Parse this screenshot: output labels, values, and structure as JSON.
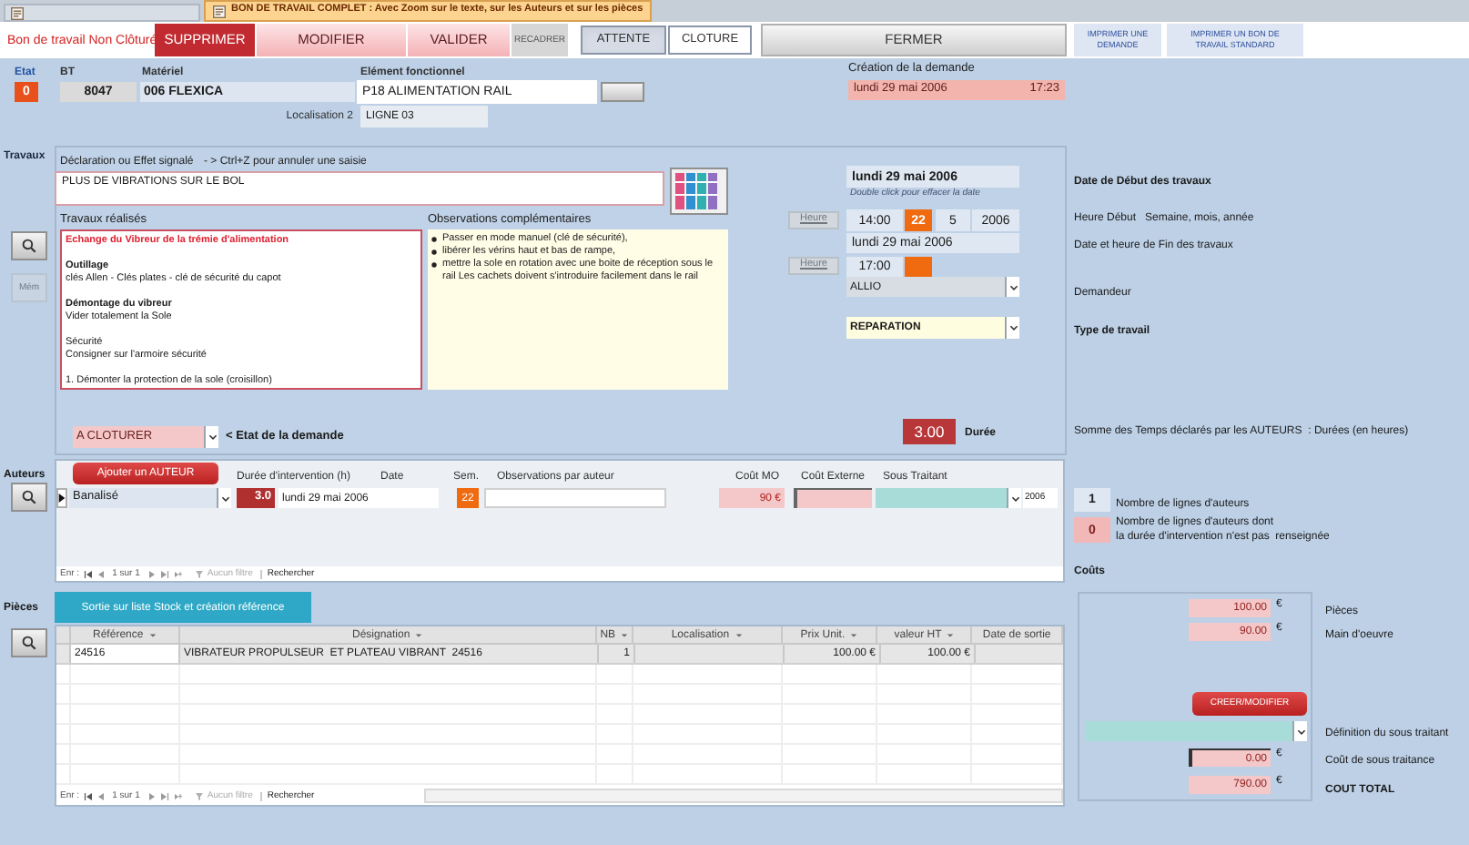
{
  "tabs": [
    {
      "selected": false
    },
    {
      "label": "BON DE TRAVAIL COMPLET : Avec Zoom sur le texte, sur les Auteurs et sur les pièces",
      "selected": true
    }
  ],
  "header": {
    "status": "Bon de travail Non Clôturé",
    "buttons": [
      {
        "label": "SUPPRIMER",
        "kind": "danger"
      },
      {
        "label": "MODIFIER",
        "kind": "action"
      },
      {
        "label": "VALIDER",
        "kind": "action"
      },
      {
        "label": "RECADRER",
        "kind": "minor"
      },
      {
        "label": "ATTENTE",
        "kind": "toggle",
        "selected": true
      },
      {
        "label": "CLOTURE",
        "kind": "toggle",
        "selected": false
      },
      {
        "label": "FERMER",
        "kind": "plain"
      },
      {
        "label": "IMPRIMER UNE DEMANDE",
        "kind": "print"
      },
      {
        "label": "IMPRIMER UN BON DE TRAVAIL STANDARD",
        "kind": "print"
      }
    ]
  },
  "identification": {
    "etat": {
      "label": "Etat",
      "value": "0"
    },
    "bt": {
      "label": "BT",
      "value": "8047"
    },
    "materiel": {
      "label": "Matériel",
      "value": "006 FLEXICA"
    },
    "element": {
      "label": "Elément fonctionnel",
      "value": "P18 ALIMENTATION RAIL"
    },
    "localisation": {
      "label": "Localisation 2",
      "value": "LIGNE 03"
    },
    "creation": {
      "label": "Création de la demande",
      "date": "lundi 29 mai 2006",
      "time": "17:23"
    }
  },
  "travaux": {
    "label": "Travaux",
    "side_buttons": [
      {
        "kind": "zoom",
        "disabled": false
      },
      {
        "kind": "memo",
        "label": "Mém",
        "disabled": true
      }
    ],
    "declaration": {
      "label": "Déclaration ou Effet signalé",
      "hint": "- > Ctrl+Z pour annuler une saisie",
      "value": "PLUS DE VIBRATIONS SUR LE BOL"
    },
    "realises": {
      "label": "Travaux réalisés",
      "blocks": [
        {
          "kind": "title",
          "lines": [
            "Echange du Vibreur de la trémie d'alimentation"
          ]
        },
        {
          "kind": "section",
          "heading": "Outillage",
          "lines": [
            " clés Allen - Clés plates - clé de sécurité du capot"
          ]
        },
        {
          "kind": "section",
          "heading": "Démontage du vibreur",
          "lines": [
            "Vider totalement la Sole"
          ]
        },
        {
          "kind": "plain",
          "lines": [
            "Sécurité",
            "Consigner sur l'armoire sécurité"
          ]
        },
        {
          "kind": "plain",
          "lines": [
            "1. Démonter la protection de la sole (croisillon)"
          ]
        }
      ]
    },
    "observations": {
      "label": "Observations complémentaires",
      "bullets": [
        "Passer en mode manuel (clé de sécurité),",
        "libérer les vérins haut et bas de rampe,",
        "mettre la sole en rotation avec une boite de réception sous le rail  Les cachets doivent s'introduire facilement dans le rail"
      ]
    },
    "planning": {
      "start_date": "lundi 29 mai 2006",
      "hint": "Double click pour effacer la date",
      "start_button": {
        "label": "Heure",
        "disabled": true
      },
      "start_time": "14:00",
      "week": "22",
      "month": "5",
      "year": "2006",
      "end_date": "lundi 29 mai 2006",
      "end_button": {
        "label": "Heure",
        "disabled": true
      },
      "end_time": "17:00",
      "demandeur": "ALLIO",
      "type": "REPARATION"
    },
    "label_start": "Date de Début des travaux",
    "label_start_time": "Heure Début   Semaine, mois, année",
    "label_end": "Date et heure de Fin des travaux",
    "label_demandeur": "Demandeur",
    "label_type": "Type de travail",
    "etat_demande": {
      "value": "A CLOTURER",
      "label": "< Etat de la demande"
    },
    "duree": {
      "value": "3.00",
      "label": "Durée",
      "note": "Somme des Temps déclarés par les AUTEURS  : Durées (en heures)"
    }
  },
  "auteurs": {
    "label": "Auteurs",
    "add_button": "Ajouter un AUTEUR",
    "columns": [
      "Durée d'intervention (h)",
      "Date",
      "Sem.",
      "Observations par auteur",
      "Coût MO",
      "Coût Externe",
      "Sous Traitant"
    ],
    "rows": [
      {
        "selected": true,
        "auteur": "Banalisé",
        "duree": "3.0",
        "date": "lundi 29 mai 2006",
        "sem": "22",
        "cout_mo": "90 €",
        "annee": "2006"
      }
    ],
    "navigator": {
      "prefix": "Enr :",
      "position": "1 sur 1",
      "filter": "Aucun filtre",
      "search": "Rechercher"
    },
    "counts": [
      {
        "value": "1",
        "label": "Nombre de lignes d'auteurs"
      },
      {
        "value": "0",
        "label": "Nombre de lignes d'auteurs dont\nla durée d'intervention n'est pas  renseignée"
      }
    ]
  },
  "pieces": {
    "label": "Pièces",
    "stock_button": "Sortie sur liste Stock et création référence",
    "columns": [
      {
        "label": "Référence",
        "filter": true
      },
      {
        "label": "Désignation",
        "filter": true
      },
      {
        "label": "NB",
        "filter": true
      },
      {
        "label": "Localisation",
        "filter": true
      },
      {
        "label": "Prix Unit.",
        "filter": true
      },
      {
        "label": "valeur HT",
        "filter": true
      },
      {
        "label": "Date de sortie",
        "filter": false
      }
    ],
    "rows": [
      {
        "reference": "24516",
        "designation": "VIBRATEUR PROPULSEUR  ET PLATEAU VIBRANT  24516",
        "nb": "1",
        "prix_unit": "100.00 €",
        "valeur_ht": "100.00 €"
      }
    ],
    "navigator": {
      "prefix": "Enr :",
      "position": "1 sur 1",
      "filter": "Aucun filtre",
      "search": "Rechercher"
    }
  },
  "couts": {
    "label": "Coûts",
    "pieces": {
      "value": "100.00",
      "currency": "€",
      "label": "Pièces"
    },
    "main_oeuvre": {
      "value": "90.00",
      "currency": "€",
      "label": "Main d'oeuvre"
    },
    "button": "CREER/MODIFIER",
    "sous_traitant_label": "Définition du sous traitant",
    "sous_traitance": {
      "value": "0.00",
      "currency": "€",
      "label": "Coût de sous traitance"
    },
    "total": {
      "value": "790.00",
      "currency": "€",
      "label": "COUT TOTAL"
    }
  }
}
